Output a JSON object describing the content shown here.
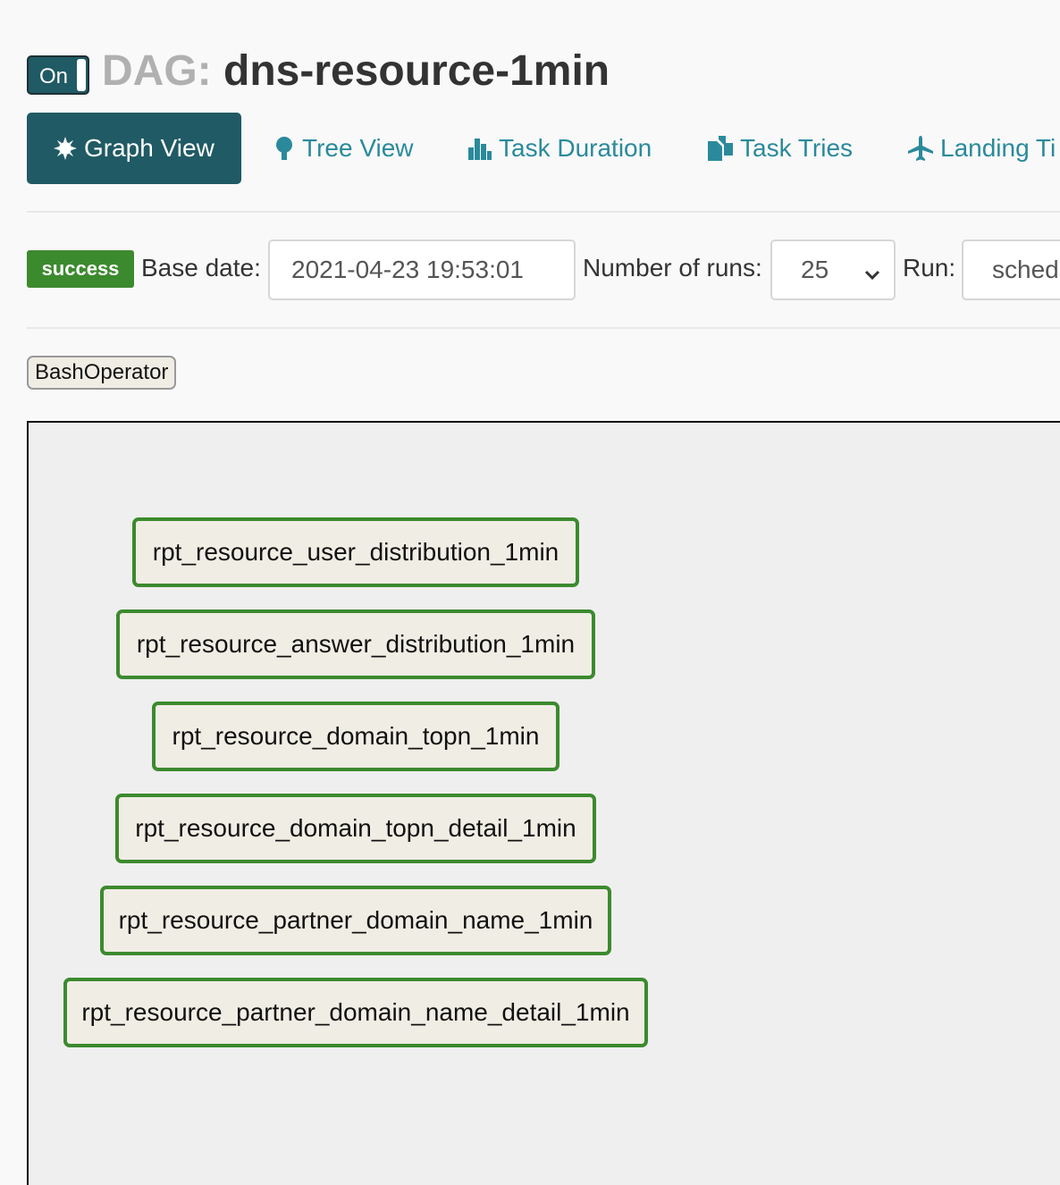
{
  "header": {
    "toggle_label": "On",
    "dag_prefix": "DAG:",
    "dag_name": "dns-resource-1min"
  },
  "tabs": [
    {
      "label": "Graph View",
      "icon": "asterisk-icon",
      "active": true
    },
    {
      "label": "Tree View",
      "icon": "tree-icon",
      "active": false
    },
    {
      "label": "Task Duration",
      "icon": "bar-chart-icon",
      "active": false
    },
    {
      "label": "Task Tries",
      "icon": "duplicate-file-icon",
      "active": false
    },
    {
      "label": "Landing Ti",
      "icon": "plane-icon",
      "active": false
    }
  ],
  "controls": {
    "status": "success",
    "base_date_label": "Base date:",
    "base_date_value": "2021-04-23 19:53:01",
    "runs_label": "Number of runs:",
    "runs_value": "25",
    "run_label": "Run:",
    "run_value": "sched"
  },
  "legend": {
    "operator": "BashOperator"
  },
  "graph": {
    "nodes": [
      {
        "label": "rpt_resource_user_distribution_1min"
      },
      {
        "label": "rpt_resource_answer_distribution_1min"
      },
      {
        "label": "rpt_resource_domain_topn_1min"
      },
      {
        "label": "rpt_resource_domain_topn_detail_1min"
      },
      {
        "label": "rpt_resource_partner_domain_name_1min"
      },
      {
        "label": "rpt_resource_partner_domain_name_detail_1min"
      }
    ]
  },
  "colors": {
    "primary": "#205a64",
    "link": "#2a8a9b",
    "success": "#3c8a2e",
    "node_fill": "#f0ede4"
  }
}
